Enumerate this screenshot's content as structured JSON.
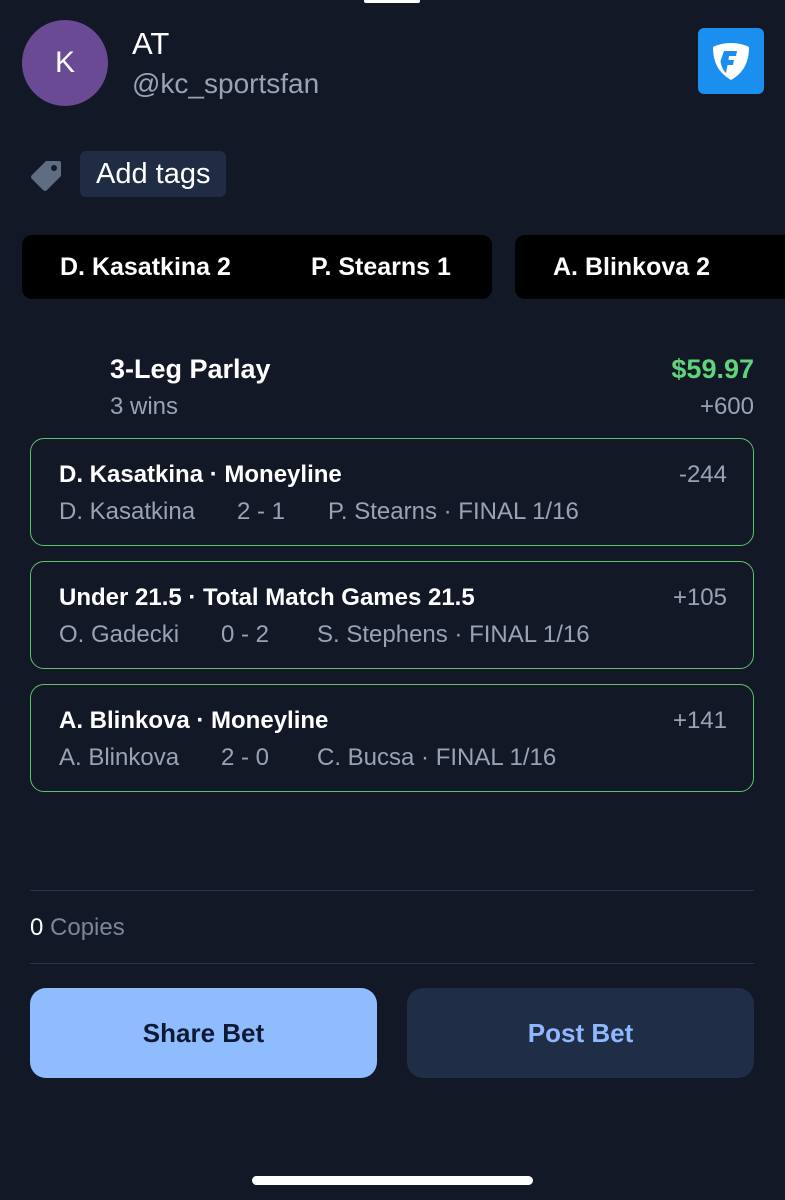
{
  "header": {
    "avatar_initial": "K",
    "name": "AT",
    "handle": "@kc_sportsfan",
    "app_logo_icon": "fanduel-shield-icon"
  },
  "tags": {
    "icon": "tag-icon",
    "button_label": "Add tags"
  },
  "scoreboards": [
    {
      "player1": "D. Kasatkina 2",
      "player2": "P. Stearns 1"
    },
    {
      "player1": "A. Blinkova 2"
    }
  ],
  "parlay": {
    "title": "3-Leg Parlay",
    "subtitle": "3 wins",
    "payout": "$59.97",
    "odds": "+600"
  },
  "legs": [
    {
      "title": "D. Kasatkina · Moneyline",
      "odds": "-244",
      "player": "D. Kasatkina",
      "score": "2 - 1",
      "opponent": "P. Stearns · FINAL 1/16"
    },
    {
      "title": "Under 21.5 · Total Match Games 21.5",
      "odds": "+105",
      "player": "O. Gadecki",
      "score": "0 - 2",
      "opponent": "S. Stephens · FINAL 1/16"
    },
    {
      "title": "A. Blinkova · Moneyline",
      "odds": "+141",
      "player": "A. Blinkova",
      "score": "2 - 0",
      "opponent": "C. Bucsa · FINAL 1/16"
    }
  ],
  "copies": {
    "count": "0",
    "label": "Copies"
  },
  "actions": {
    "share_label": "Share Bet",
    "post_label": "Post Bet"
  },
  "colors": {
    "background": "#121826",
    "win_green": "#5fd47a",
    "leg_border": "#5fc06c",
    "share_button": "#8fbcff",
    "post_button": "#1f2d47",
    "avatar": "#6a4a95",
    "logo_blue": "#1b8ff0"
  }
}
